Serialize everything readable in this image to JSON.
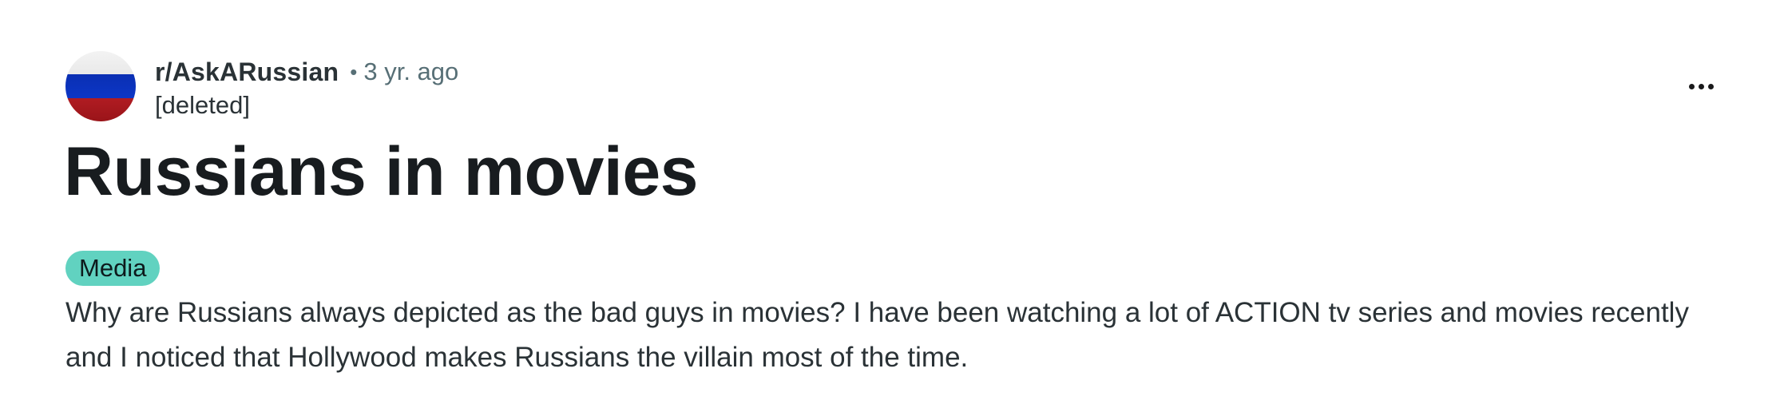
{
  "post": {
    "subreddit": "r/AskARussian",
    "separator": "•",
    "time_ago": "3 yr. ago",
    "author": "[deleted]",
    "avatar_icon": "russian-flag-avatar-icon",
    "more_icon": "more-options-icon",
    "title": "Russians in movies",
    "flair": "Media",
    "body": "Why are Russians always depicted as the bad guys in movies? I have been watching a lot of ACTION tv series and movies recently and I noticed that Hollywood makes Russians the villain most of the time."
  },
  "colors": {
    "flair_background": "#61d2c0",
    "flag_white": "#f3f3f3",
    "flag_blue": "#0c36c6",
    "flag_red": "#b01c22",
    "meta_text": "#576f76"
  }
}
